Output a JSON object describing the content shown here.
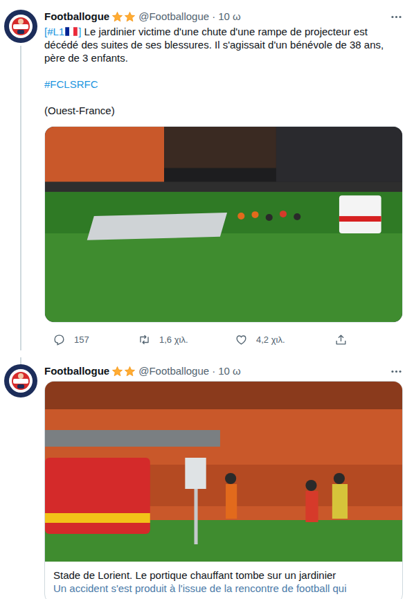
{
  "tweets": [
    {
      "author": "Footballogue",
      "handle": "@Footballogue",
      "separator": "·",
      "time": "10 ω",
      "paragraphs": [
        [
          {
            "kind": "link",
            "text": "[#L1"
          },
          {
            "kind": "flag"
          },
          {
            "kind": "link",
            "text": "]"
          },
          {
            "kind": "plain",
            "text": " Le jardinier victime d'une chute d'une rampe de projecteur est décédé des suites de ses blessures. Il s'agissait d'un bénévole de 38 ans, père de 3 enfants."
          }
        ],
        [
          {
            "kind": "link",
            "text": "#FCLSRFC"
          }
        ],
        [
          {
            "kind": "plain",
            "text": "(Ouest-France)"
          }
        ]
      ],
      "actions": [
        {
          "kind": "reply",
          "count": "157"
        },
        {
          "kind": "retweet",
          "count": "1,6 χιλ."
        },
        {
          "kind": "like",
          "count": "4,2 χιλ."
        },
        {
          "kind": "share"
        }
      ]
    },
    {
      "author": "Footballogue",
      "handle": "@Footballogue",
      "separator": "·",
      "time": "10 ω",
      "card": {
        "title": "Stade de Lorient. Le portique chauffant tombe sur un jardinier",
        "description": "Un accident s'est produit à l'issue de la rencontre de football qui"
      }
    }
  ]
}
